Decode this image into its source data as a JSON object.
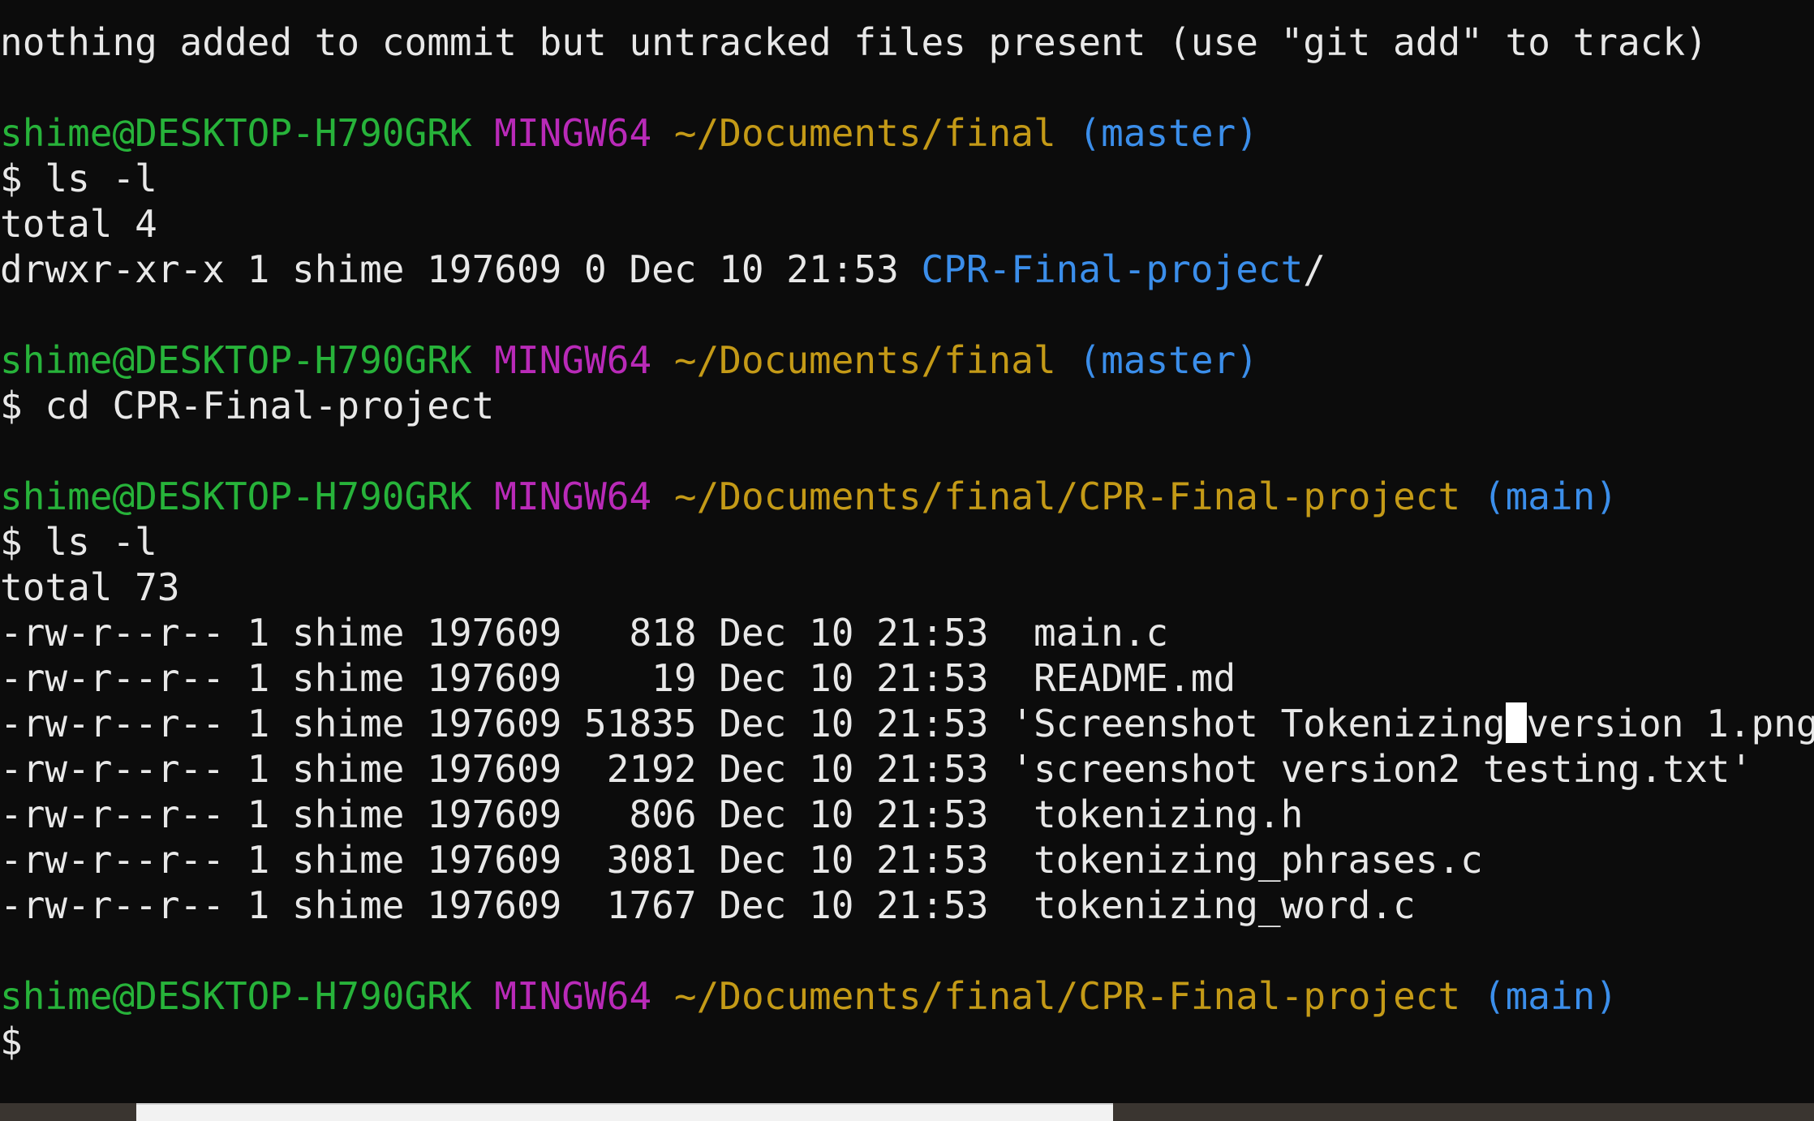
{
  "prompt": {
    "user": "shime@DESKTOP-H790GRK",
    "env": "MINGW64",
    "symbol": "$"
  },
  "blocks": {
    "status": "nothing added to commit but untracked files present (use \"git add\" to track)",
    "p1": {
      "path": "~/Documents/final",
      "branch": "(master)",
      "cmd": "ls -l",
      "total": "total 4",
      "entry_meta": "drwxr-xr-x 1 shime 197609 0 Dec 10 21:53 ",
      "entry_dir": "CPR-Final-project",
      "entry_slash": "/"
    },
    "p2": {
      "path": "~/Documents/final",
      "branch": "(master)",
      "cmd": "cd CPR-Final-project"
    },
    "p3": {
      "path": "~/Documents/final/CPR-Final-project",
      "branch": "(main)",
      "cmd": "ls -l",
      "total": "total 73"
    },
    "files": [
      "-rw-r--r-- 1 shime 197609   818 Dec 10 21:53  main.c",
      "-rw-r--r-- 1 shime 197609    19 Dec 10 21:53  README.md",
      "-rw-r--r-- 1 shime 197609  2192 Dec 10 21:53 'screenshot version2 testing.txt'",
      "-rw-r--r-- 1 shime 197609   806 Dec 10 21:53  tokenizing.h",
      "-rw-r--r-- 1 shime 197609  3081 Dec 10 21:53  tokenizing_phrases.c",
      "-rw-r--r-- 1 shime 197609  1767 Dec 10 21:53  tokenizing_word.c"
    ],
    "file_png_a": "-rw-r--r-- 1 shime 197609 51835 Dec 10 21:53 'Screenshot Tokenizing",
    "file_png_b": "version 1.png'",
    "p4": {
      "path": "~/Documents/final/CPR-Final-project",
      "branch": "(main)"
    }
  },
  "colors": {
    "background": "#0c0c0c",
    "text": "#e8e8e8",
    "user": "#27b33a",
    "env": "#b92ab8",
    "path": "#c49a17",
    "branch": "#3b8eea"
  }
}
